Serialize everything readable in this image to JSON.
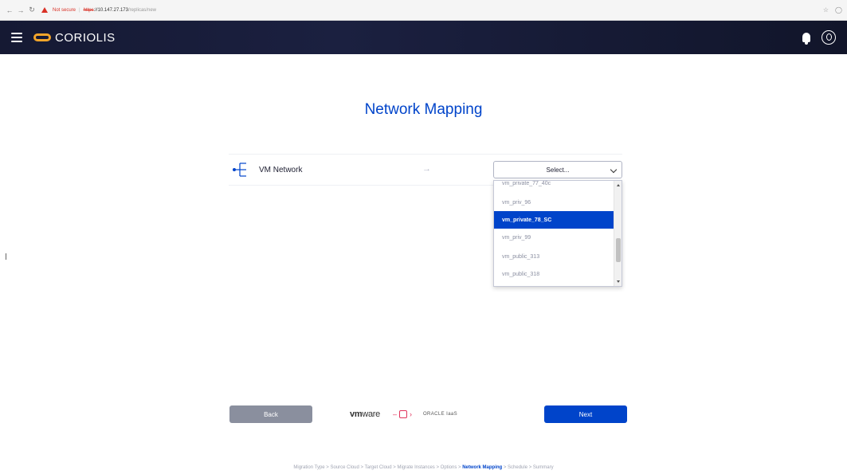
{
  "browser": {
    "not_secure": "Not secure",
    "separator": "|",
    "url_scheme": "https",
    "url_host": "://10.147.27.173",
    "url_path": "/replicas/new"
  },
  "header": {
    "logo_text": "CORIOLIS",
    "accent_color": "#f3a52a"
  },
  "page": {
    "title": "Network Mapping"
  },
  "mapping": {
    "source_network": "VM Network",
    "select_placeholder": "Select...",
    "options": [
      "vm_private_77_40c",
      "vm_priv_96",
      "vm_private_78_SC",
      "vm_priv_99",
      "vm_public_313",
      "vm_public_318"
    ],
    "selected_option": "vm_private_78_SC"
  },
  "footer": {
    "back_label": "Back",
    "next_label": "Next",
    "source_cloud_prefix": "vm",
    "source_cloud_suffix": "ware",
    "target_cloud": "ORACLE IaaS"
  },
  "steps": {
    "items": [
      "Migration Type",
      "Source Cloud",
      "Target Cloud",
      "Migrate Instances",
      "Options",
      "Network Mapping",
      "Schedule",
      "Summary"
    ],
    "active": "Network Mapping",
    "separator": " > "
  },
  "colors": {
    "primary": "#0044ca",
    "back_button": "#8a8f9e",
    "header_bg": "#151933"
  }
}
